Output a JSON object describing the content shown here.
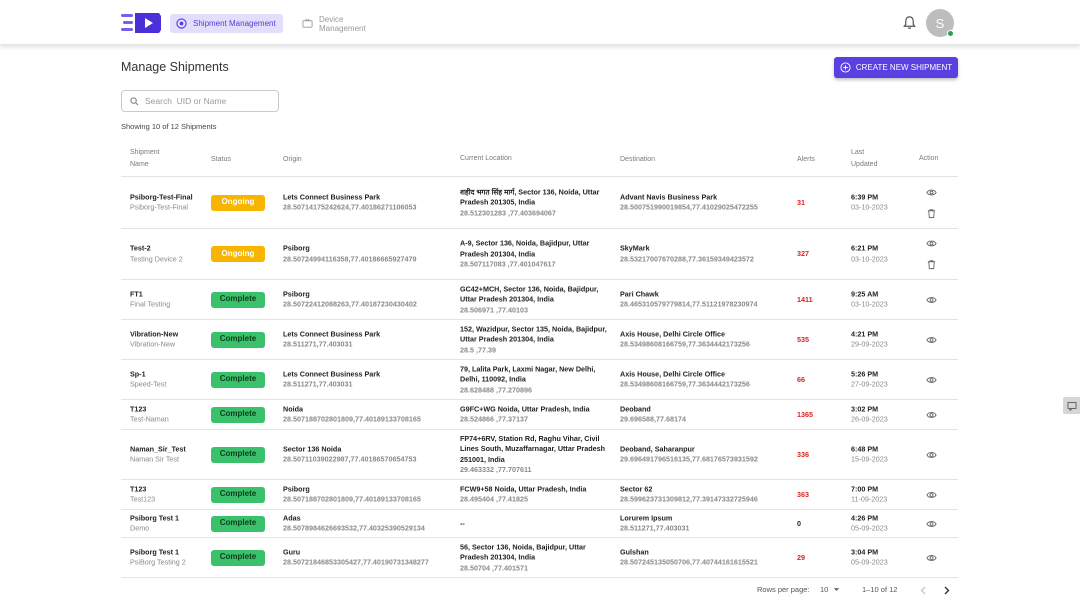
{
  "nav": {
    "tabs": [
      {
        "label": "Shipment Management",
        "icon": "shipment-icon",
        "active": true
      },
      {
        "label": "Device Management",
        "icon": "device-icon",
        "active": false
      }
    ],
    "avatar_initial": "S"
  },
  "page": {
    "title": "Manage Shipments",
    "create_button": "CREATE NEW SHIPMENT",
    "search_placeholder": "Search  UID or Name",
    "count_text": "Showing 10 of 12 Shipments"
  },
  "table": {
    "headers": {
      "name": [
        "Shipment",
        "Name"
      ],
      "status": "Status",
      "origin": "Origin",
      "current": "Current Location",
      "destination": "Destination",
      "alerts": "Alerts",
      "updated": [
        "Last",
        "Updated"
      ],
      "action": "Action"
    },
    "rows": [
      {
        "name": "Psiborg-Test-Final",
        "sub": "Psiborg-Test-Final",
        "status": "Ongoing",
        "origin": "Lets Connect Business Park",
        "origin_coord": "28.50714175242624,77.40186271106053",
        "current": "शहीद भगत सिंह मार्ग, Sector 136, Noida, Uttar Pradesh 201305, India",
        "current_coord": "28.512301283 ,77.403694067",
        "dest": "Advant Navis Business Park",
        "dest_coord": "28.500751990019854,77.41029025472255",
        "alerts": "31",
        "time": "6:39 PM",
        "date": "03-10-2023",
        "deletable": true
      },
      {
        "name": "Test-2",
        "sub": "Testing Device 2",
        "status": "Ongoing",
        "origin": "Psiborg",
        "origin_coord": "28.50724994116358,77.40186665927479",
        "current": "A-9, Sector 136, Noida, Bajidpur, Uttar Pradesh 201304, India",
        "current_coord": "28.507117083 ,77.401047617",
        "dest": "SkyMark",
        "dest_coord": "28.53217007670288,77.36159349423572",
        "alerts": "327",
        "time": "6:21 PM",
        "date": "03-10-2023",
        "deletable": true
      },
      {
        "name": "FT1",
        "sub": "Final Testing",
        "status": "Complete",
        "origin": "Psiborg",
        "origin_coord": "28.50722412088263,77.40187230430402",
        "current": "GC42+MCH, Sector 136, Noida, Bajidpur, Uttar Pradesh 201304, India",
        "current_coord": "28.506971 ,77.40103",
        "dest": "Pari Chawk",
        "dest_coord": "28.465310579779814,77.51121978230974",
        "alerts": "1411",
        "time": "9:25 AM",
        "date": "03-10-2023",
        "deletable": false
      },
      {
        "name": "Vibration-New",
        "sub": "Vibration-New",
        "status": "Complete",
        "origin": "Lets Connect Business Park",
        "origin_coord": "28.511271,77.403031",
        "current": "152, Wazidpur, Sector 135, Noida, Bajidpur, Uttar Pradesh 201304, India",
        "current_coord": "28.5 ,77.39",
        "dest": "Axis House, Delhi Circle Office",
        "dest_coord": "28.53498608166759,77.3634442173256",
        "alerts": "535",
        "time": "4:21 PM",
        "date": "29-09-2023",
        "deletable": false
      },
      {
        "name": "Sp-1",
        "sub": "Speed-Test",
        "status": "Complete",
        "origin": "Lets Connect Business Park",
        "origin_coord": "28.511271,77.403031",
        "current": "79, Lalita Park, Laxmi Nagar, New Delhi, Delhi, 110092, India",
        "current_coord": "28.628488 ,77.270896",
        "dest": "Axis House, Delhi Circle Office",
        "dest_coord": "28.53498608166759,77.3634442173256",
        "alerts": "66",
        "time": "5:26 PM",
        "date": "27-09-2023",
        "deletable": false
      },
      {
        "name": "T123",
        "sub": "Test-Naman",
        "status": "Complete",
        "origin": "Noida",
        "origin_coord": "28.507188702801809,77.40189133708165",
        "current": "G9FC+WG Noida, Uttar Pradesh, India",
        "current_coord": "28.524866 ,77.37137",
        "dest": "Deoband",
        "dest_coord": "29.696588,77.68174",
        "alerts": "1365",
        "time": "3:02 PM",
        "date": "26-09-2023",
        "deletable": false
      },
      {
        "name": "Naman_Sir_Test",
        "sub": "Naman Sir Test",
        "status": "Complete",
        "origin": "Sector 136 Noida",
        "origin_coord": "28.50711039022987,77.40186570654753",
        "current": "FP74+6RV, Station Rd, Raghu Vihar, Civil Lines South, Muzaffarnagar, Uttar Pradesh 251001, India",
        "current_coord": "29.463332 ,77.707611",
        "dest": "Deoband, Saharanpur",
        "dest_coord": "29.696491796516135,77.68176573931592",
        "alerts": "336",
        "time": "6:48 PM",
        "date": "15-09-2023",
        "deletable": false
      },
      {
        "name": "T123",
        "sub": "Test123",
        "status": "Complete",
        "origin": "Psiborg",
        "origin_coord": "28.507188702801809,77.40189133708165",
        "current": "FCW9+58 Noida, Uttar Pradesh, India",
        "current_coord": "28.495404 ,77.41825",
        "dest": "Sector 62",
        "dest_coord": "28.599623731309812,77.39147332725946",
        "alerts": "363",
        "time": "7:00 PM",
        "date": "11-09-2023",
        "deletable": false
      },
      {
        "name": "Psiborg Test 1",
        "sub": "Demo",
        "status": "Complete",
        "origin": "Adas",
        "origin_coord": "28.5078984626693532,77.40325390529134",
        "current": "--",
        "current_coord": "",
        "dest": "Lorurem Ipsum",
        "dest_coord": "28.511271,77.403031",
        "alerts": "0",
        "time": "4:26 PM",
        "date": "05-09-2023",
        "deletable": false
      },
      {
        "name": "Psiborg Test 1",
        "sub": "PsiBorg Testing 2",
        "status": "Complete",
        "origin": "Guru",
        "origin_coord": "28.50721846853305427,77.40190731348277",
        "current": "56, Sector 136, Noida, Bajidpur, Uttar Pradesh 201304, India",
        "current_coord": "28.50704 ,77.401571",
        "dest": "Gulshan",
        "dest_coord": "28.507245135050706,77.40744161615521",
        "alerts": "29",
        "time": "3:04 PM",
        "date": "05-09-2023",
        "deletable": false
      }
    ]
  },
  "pagination": {
    "rows_label": "Rows per page:",
    "rows_value": "10",
    "range": "1–10 of 12"
  },
  "colors": {
    "accent": "#5b3fe0",
    "ongoing": "#f7b500",
    "complete": "#3bc16c",
    "alert": "#e0201f"
  }
}
